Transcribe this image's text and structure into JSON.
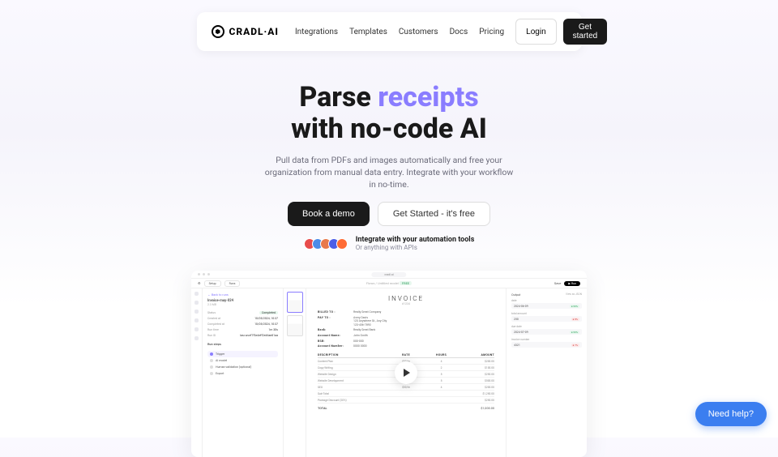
{
  "nav": {
    "brand": "CRADL·AI",
    "links": [
      "Integrations",
      "Templates",
      "Customers",
      "Docs",
      "Pricing"
    ],
    "login": "Login",
    "getStarted": "Get started"
  },
  "hero": {
    "h1_pre": "Parse ",
    "h1_accent": "receipts",
    "h1_line2": "with no-code AI",
    "sub": "Pull data from PDFs and images automatically and free your organization from manual data entry. Integrate with your workflow in no-time.",
    "demo": "Book a demo",
    "free": "Get Started - it's free",
    "integrateTitle": "Integrate with your automation tools",
    "integrateSub": "Or anything with APIs"
  },
  "shot": {
    "url": "cradl.ai",
    "toolbar": {
      "setup": "Setup",
      "runs": "Runs",
      "flow": "Flows / Untitled model",
      "badge": "FREE",
      "save": "Save",
      "run": "Run"
    },
    "left": {
      "back": "← Back to runs",
      "file": "Invoice-may-024",
      "size": "2.3 MB",
      "meta": [
        {
          "k": "Status",
          "v": "Completed",
          "badge": true
        },
        {
          "k": "Created at",
          "v": "10/05/2024, 10:37"
        },
        {
          "k": "Completed at",
          "v": "10/05/2024, 10:37"
        },
        {
          "k": "Run time",
          "v": "1m 30s"
        },
        {
          "k": "Run ID",
          "v": "las:run:ef7f3e4eff2e46ae81aa"
        }
      ],
      "stepsTitle": "Run steps",
      "steps": [
        "Trigger",
        "AI model",
        "Human validation (optional)",
        "Export"
      ]
    },
    "doc": {
      "title": "INVOICE",
      "num": "#1234",
      "billedTo": "BILLED TO :",
      "billedToVal": "Really Great Company",
      "payTo": "PAY TO :",
      "payToVal": "Avery Davis\n123 Anywhere St., Any City\n123-456-7890",
      "bank": "Bank:",
      "bankVal": "Really Great Bank",
      "accName": "Account Name:",
      "accNameVal": "John Smith",
      "bsb": "BSB:",
      "bsbVal": "000-000",
      "accNum": "Account Number:",
      "accNumVal": "0000 0000",
      "cols": [
        "DESCRIPTION",
        "RATE",
        "HOURS",
        "AMOUNT"
      ],
      "rows": [
        [
          "Content Plan",
          "$50/hr",
          "4",
          "$200.00"
        ],
        [
          "Copy Writing",
          "$50/hr",
          "2",
          "$100.00"
        ],
        [
          "Website Design",
          "$50/hr",
          "5",
          "$250.00"
        ],
        [
          "Website Development",
          "$100/hr",
          "5",
          "$500.00"
        ],
        [
          "SEO",
          "$50/hr",
          "4",
          "$200.00"
        ]
      ],
      "sub": [
        "Sub-Total",
        "",
        "",
        "$1,250.00"
      ],
      "discount": [
        "Package Discount (20%)",
        "",
        "",
        "$250.00"
      ],
      "total": [
        "TOTAL",
        "",
        "",
        "$1,000.00"
      ]
    },
    "out": {
      "title": "Output",
      "json": "View as JSON",
      "fields": [
        {
          "label": "date",
          "value": "2024-06-09",
          "conf": "99%",
          "ok": true
        },
        {
          "label": "total amount",
          "value": "250",
          "conf": "8%",
          "ok": false
        },
        {
          "label": "due date",
          "value": "2024-07-09",
          "conf": "99%",
          "ok": true
        },
        {
          "label": "invoice number",
          "value": "4321",
          "conf": "7%",
          "ok": false
        }
      ]
    }
  },
  "help": "Need help?"
}
